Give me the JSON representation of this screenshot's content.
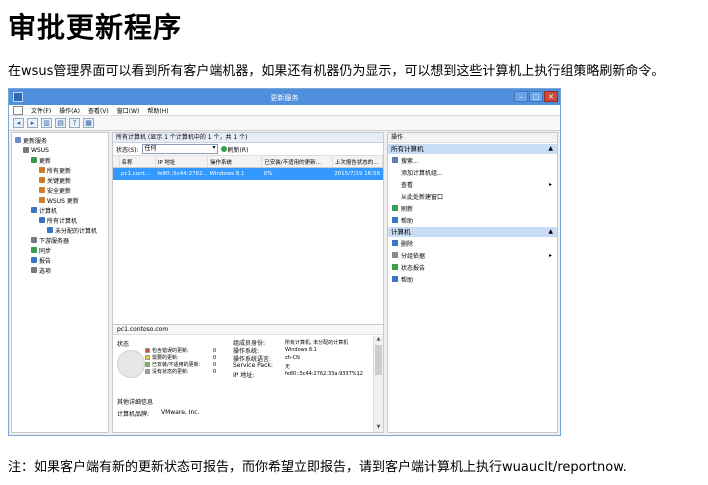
{
  "article": {
    "title": "审批更新程序",
    "intro": "在wsus管理界面可以看到所有客户端机器，如果还有机器仍为显示，可以想到这些计算机上执行组策略刷新命令。",
    "note": "注：如果客户端有新的更新状态可报告，而你希望立即报告，请到客户端计算机上执行wuauclt/reportnow."
  },
  "window": {
    "title": "更新服务",
    "minimize": "–",
    "maximize": "□",
    "close": "✕",
    "menus": [
      "文件(F)",
      "操作(A)",
      "查看(V)",
      "窗口(W)",
      "帮助(H)"
    ]
  },
  "toolbar": [
    "◂",
    "▸",
    "▥",
    "▤",
    "?",
    "▦"
  ],
  "tree": [
    {
      "label": "更新服务",
      "icon_color": "#6a8fc7",
      "indent": 0
    },
    {
      "label": "WSUS",
      "icon_color": "#7a7a7a",
      "indent": 1
    },
    {
      "label": "更新",
      "icon_color": "#3b9a4a",
      "indent": 2
    },
    {
      "label": "所有更新",
      "icon_color": "#d07a2c",
      "indent": 3
    },
    {
      "label": "关键更新",
      "icon_color": "#d07a2c",
      "indent": 3
    },
    {
      "label": "安全更新",
      "icon_color": "#d07a2c",
      "indent": 3
    },
    {
      "label": "WSUS 更新",
      "icon_color": "#d07a2c",
      "indent": 3
    },
    {
      "label": "计算机",
      "icon_color": "#3c74c4",
      "indent": 2
    },
    {
      "label": "所有计算机",
      "icon_color": "#3c74c4",
      "indent": 3
    },
    {
      "label": "未分配的计算机",
      "icon_color": "#3c74c4",
      "indent": 4
    },
    {
      "label": "下游服务器",
      "icon_color": "#7a7a7a",
      "indent": 2
    },
    {
      "label": "同步",
      "icon_color": "#3b9a4a",
      "indent": 2
    },
    {
      "label": "报告",
      "icon_color": "#3c74c4",
      "indent": 2
    },
    {
      "label": "选项",
      "icon_color": "#7a7a7a",
      "indent": 2
    }
  ],
  "center": {
    "header": "所有计算机   (显示 1 个计算机中的 1 个，共 1 个)",
    "status_label": "状态(S):",
    "status_value": "任何",
    "refresh": "刷新(R)",
    "columns": [
      "",
      "名称",
      "IP 地址",
      "操作系统",
      "已安装/不适用的更新...",
      "上次报告状态的..."
    ],
    "rows": [
      [
        "",
        "pc1.cont...",
        "fe80::5c44:2762...",
        "Windows 8.1",
        "0%",
        "2015/7/19 16:58"
      ]
    ],
    "detail_name": "pc1.contoso.com",
    "status_title": "状态",
    "legend": [
      {
        "label": "包含错误的更新:",
        "count": "0",
        "color": "#c0504d"
      },
      {
        "label": "需要的更新:",
        "count": "0",
        "color": "#e8d24a"
      },
      {
        "label": "已安装/不适用的更新:",
        "count": "0",
        "color": "#7ab648"
      },
      {
        "label": "没有状态的更新:",
        "count": "0",
        "color": "#9a9a9a"
      }
    ],
    "props": [
      {
        "k": "组成员身份:",
        "v": "所有计算机, 未分配的计算机"
      },
      {
        "k": "操作系统:",
        "v": "Windows 8.1"
      },
      {
        "k": "操作系统语言:",
        "v": "zh-CN"
      },
      {
        "k": "Service Pack:",
        "v": "无"
      },
      {
        "k": "IP 地址:",
        "v": "fe80::5c44:2762:33a:9337%12"
      }
    ],
    "more_title": "其他详细信息",
    "hw_key": "计算机品牌:",
    "hw_val": "VMware, Inc."
  },
  "actions": {
    "title": "操作",
    "sections": [
      {
        "title": "所有计算机",
        "items": [
          {
            "label": "搜索...",
            "icon_color": "#5b7fb0",
            "arrow": ""
          },
          {
            "label": "添加计算机组...",
            "icon_color": "",
            "arrow": ""
          },
          {
            "label": "查看",
            "icon_color": "",
            "arrow": "▸"
          },
          {
            "label": "从此处新建窗口",
            "icon_color": "",
            "arrow": ""
          },
          {
            "label": "刷新",
            "icon_color": "#38a048",
            "arrow": ""
          },
          {
            "label": "帮助",
            "icon_color": "#3c74c4",
            "arrow": ""
          }
        ]
      },
      {
        "title": "计算机",
        "items": [
          {
            "label": "删除",
            "icon_color": "#3c74c4",
            "arrow": ""
          },
          {
            "label": "分组依据",
            "icon_color": "#8a8a8a",
            "arrow": "▸"
          },
          {
            "label": "状态报告",
            "icon_color": "#38a048",
            "arrow": ""
          },
          {
            "label": "帮助",
            "icon_color": "#3c74c4",
            "arrow": ""
          }
        ]
      }
    ],
    "collapse": "▲"
  }
}
